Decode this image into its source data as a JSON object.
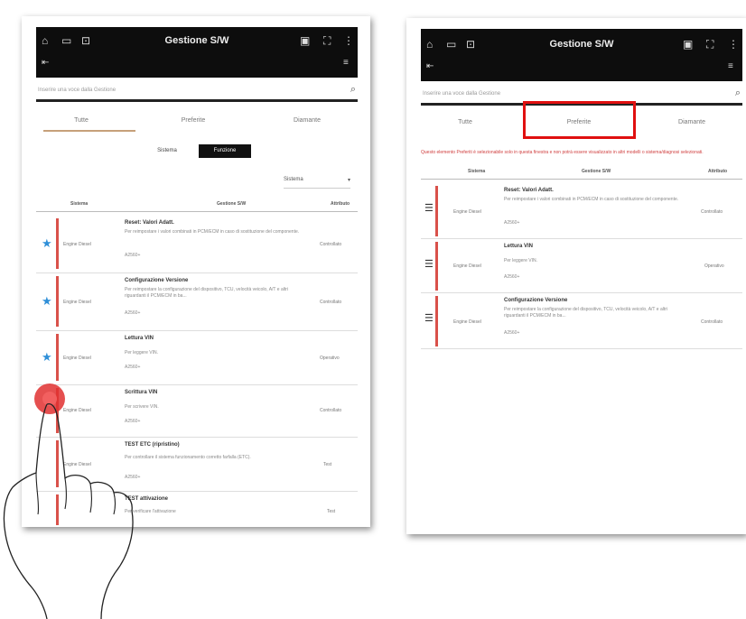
{
  "left": {
    "title": "Gestione S/W",
    "search_placeholder": "Inserire una voce dalla Gestione",
    "tabs": [
      "Tutte",
      "Preferite",
      "Diamante"
    ],
    "toggle": [
      "Sistema",
      "Funzione"
    ],
    "dropdown": "Sistema",
    "headers": [
      "Sistema",
      "Gestione S/W",
      "Attributo"
    ],
    "rows": [
      {
        "system": "Engine Diesel",
        "name": "Reset: Valori Adatt.",
        "desc": "Per reimpostare i valori combinati in PCM/ECM in caso di sostituzione del componente.",
        "code": "A2560+",
        "attr": "Controllato"
      },
      {
        "system": "Engine Diesel",
        "name": "Configurazione Versione",
        "desc": "Per reimpostare la configurazione del dispositivo, TCU, velocità veicolo, A/T e altri riguardanti il PCM/ECM in ba...",
        "code": "A2560+",
        "attr": "Controllato"
      },
      {
        "system": "Engine Diesel",
        "name": "Lettura VIN",
        "desc": "Per leggere VIN.",
        "code": "A2560+",
        "attr": "Operativo"
      },
      {
        "system": "Engine Diesel",
        "name": "Scrittura VIN",
        "desc": "Per scrivere VIN.",
        "code": "A2560+",
        "attr": "Controllato"
      },
      {
        "system": "Engine Diesel",
        "name": "TEST ETC (ripristino)",
        "desc": "Per controllare il sistema funzionamento corretto farfalla (ETC).",
        "code": "A2560+",
        "attr": "Test"
      },
      {
        "system": "",
        "name": "TEST attivazione",
        "desc": "Per verificare l'attivazione",
        "code": "",
        "attr": "Test"
      }
    ]
  },
  "right": {
    "title": "Gestione S/W",
    "search_placeholder": "Inserire una voce dalla Gestione",
    "tabs": [
      "Tutte",
      "Preferite",
      "Diamante"
    ],
    "notice": "Questo elemento Preferiti è selezionabile solo in questa finestra e non potrà essere visualizzato in altri modelli o sistema/diagnosi selezionati.",
    "headers": [
      "Sistema",
      "Gestione S/W",
      "Attributo"
    ],
    "rows": [
      {
        "system": "Engine Diesel",
        "name": "Reset: Valori Adatt.",
        "desc": "Per reimpostare i valori combinati in PCM/ECM in caso di sostituzione del componente.",
        "code": "A2560+",
        "attr": "Controllato"
      },
      {
        "system": "Engine Diesel",
        "name": "Lettura VIN",
        "desc": "Per leggere VIN.",
        "code": "A2560+",
        "attr": "Operativo"
      },
      {
        "system": "Engine Diesel",
        "name": "Configurazione Versione",
        "desc": "Per reimpostare la configurazione del dispositivo, TCU, velocità veicolo, A/T e altri riguardanti il PCM/ECM in ba...",
        "code": "A2560+",
        "attr": "Controllato"
      }
    ]
  },
  "colors": {
    "accent_bar": "#d9514a",
    "highlight": "#e01010",
    "star": "#2f8fd8",
    "topbar": "#0d0d0d"
  }
}
